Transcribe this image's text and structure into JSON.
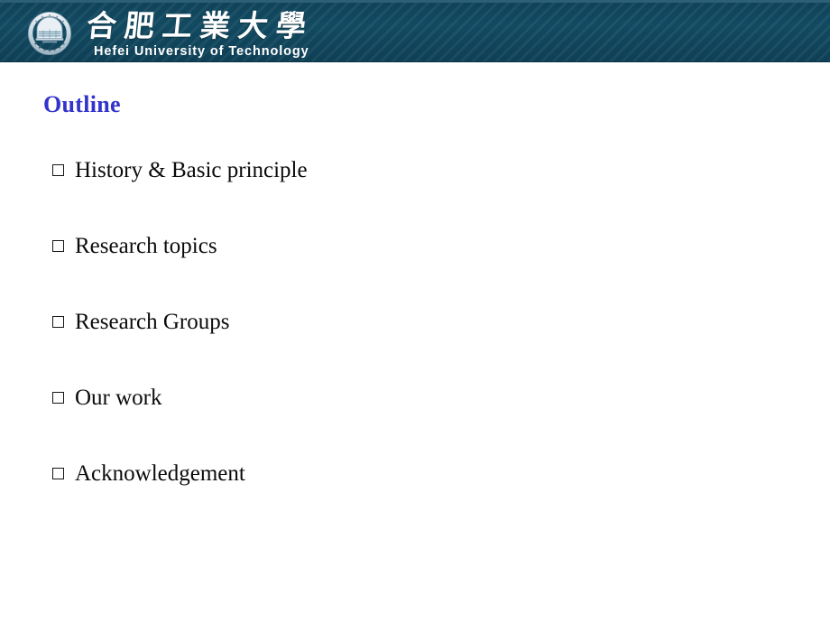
{
  "header": {
    "logo_icon": "university-seal-icon",
    "chinese_name": "合肥工業大學",
    "english_name": "Hefei University of Technology",
    "background_color": "#134b63",
    "top_accent_color": "#2b6077"
  },
  "slide": {
    "title": "Outline",
    "title_color": "#3333cc",
    "background_color": "#ffffff",
    "bullet_glyph": "□",
    "items": [
      {
        "label": "History & Basic principle"
      },
      {
        "label": "Research topics"
      },
      {
        "label": "Research Groups"
      },
      {
        "label": "Our work"
      },
      {
        "label": "Acknowledgement"
      }
    ]
  }
}
